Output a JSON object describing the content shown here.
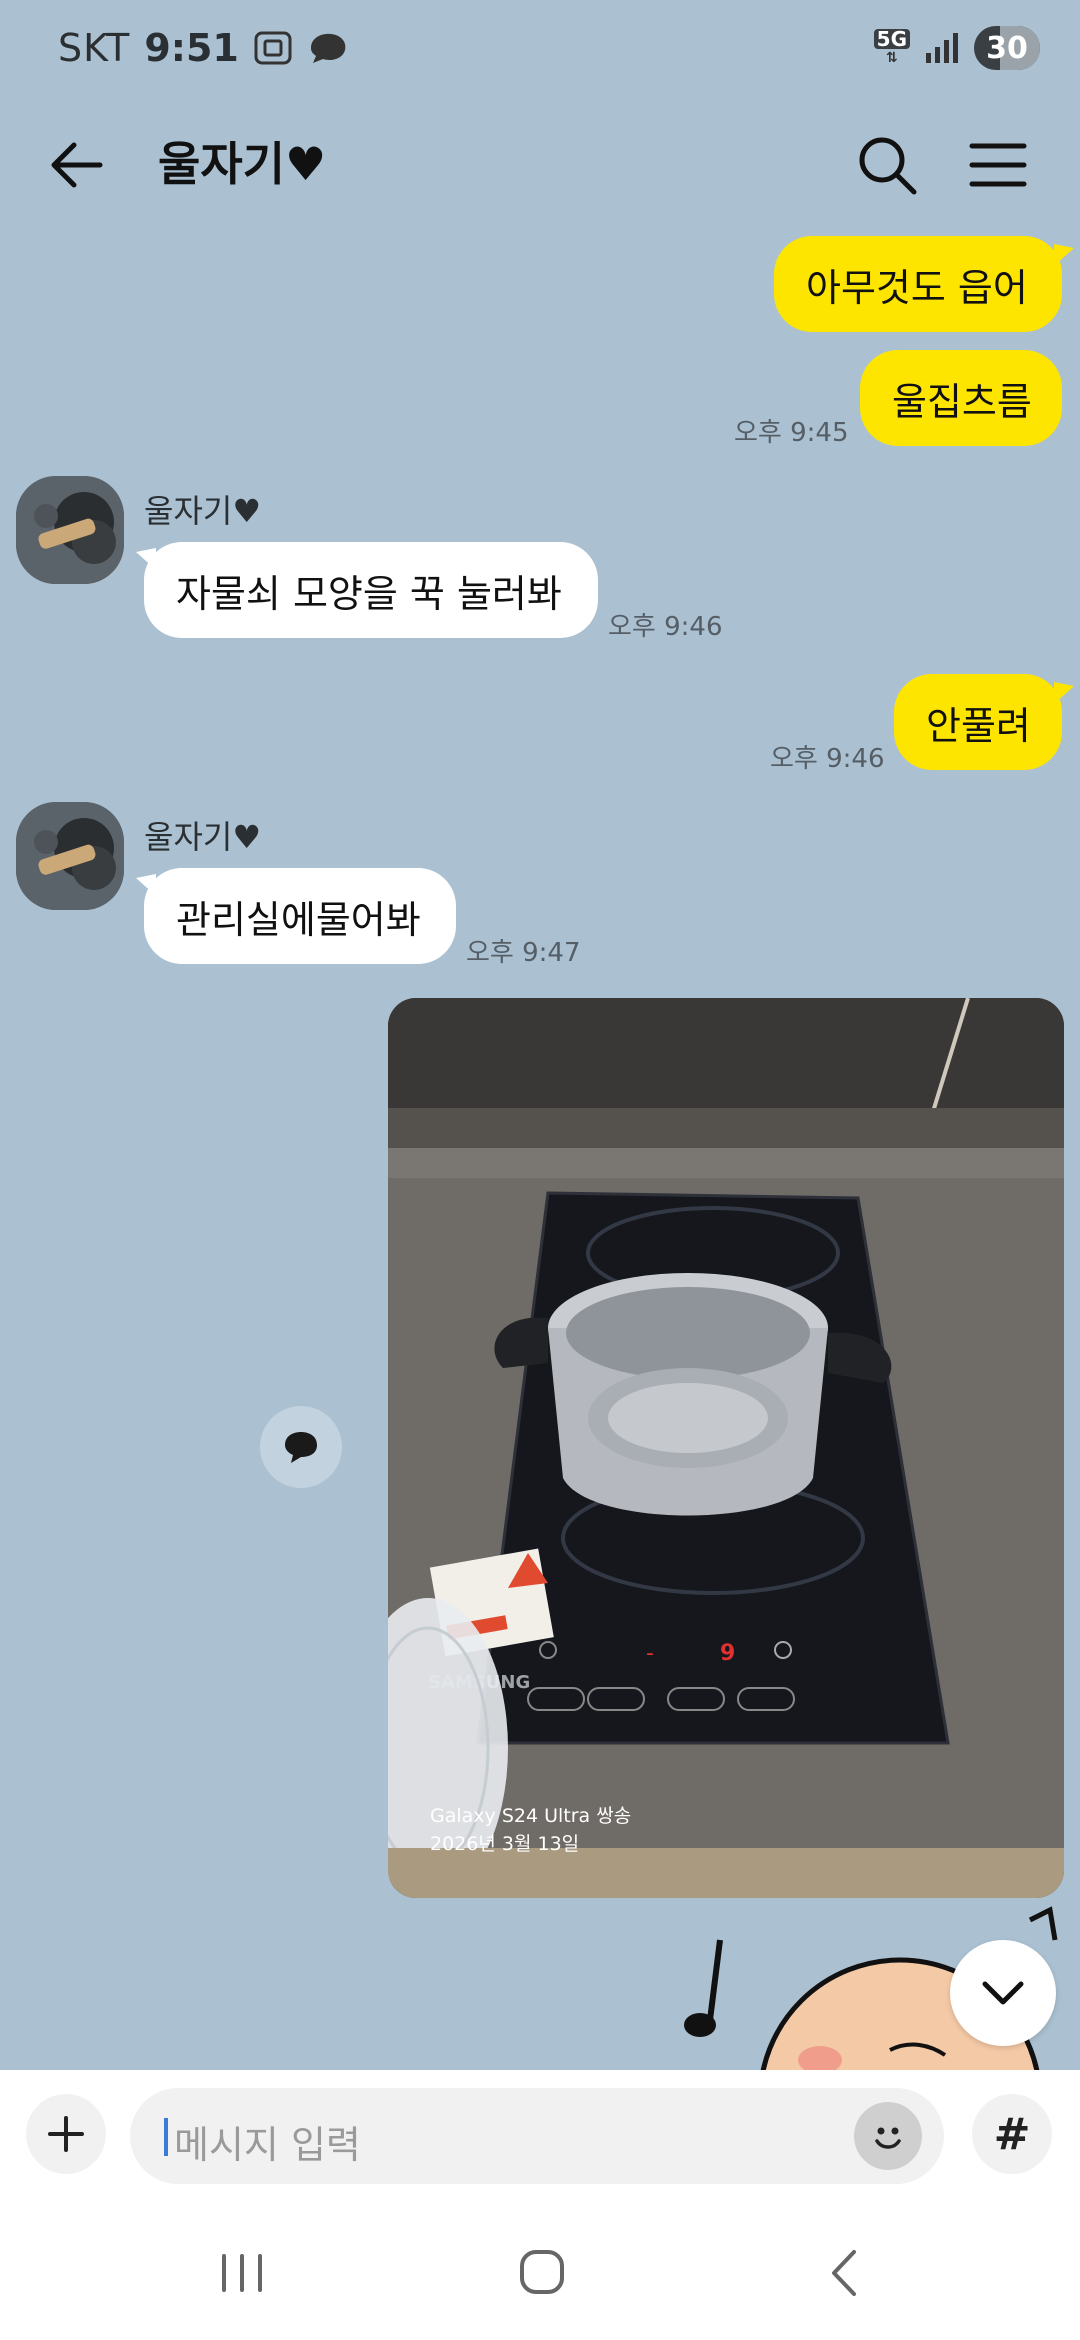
{
  "status_bar": {
    "carrier": "SKT",
    "time": "9:51",
    "network": "5G",
    "battery": "30"
  },
  "header": {
    "title": "울자기♥"
  },
  "messages": [
    {
      "from": "me",
      "text": "아무것도 읍어"
    },
    {
      "from": "me",
      "text": "울집츠름",
      "time": "오후 9:45"
    },
    {
      "from": "other",
      "sender": "울자기♥",
      "text": "자물쇠 모양을 꾹 눌러봐",
      "time": "오후 9:46"
    },
    {
      "from": "me",
      "text": "안풀려",
      "time": "오후 9:46"
    },
    {
      "from": "other",
      "sender": "울자기♥",
      "text": "관리실에물어봐",
      "time": "오후 9:47"
    }
  ],
  "photo": {
    "caption_line1": "Galaxy S24 Ultra 쌍송",
    "caption_line2": "2026년 3월 13일",
    "brand_label": "SAMSUNG"
  },
  "input_bar": {
    "placeholder": "메시지 입력",
    "hash_label": "#"
  },
  "colors": {
    "background": "#abc1d1",
    "my_bubble": "#fee500",
    "other_bubble": "#ffffff"
  }
}
